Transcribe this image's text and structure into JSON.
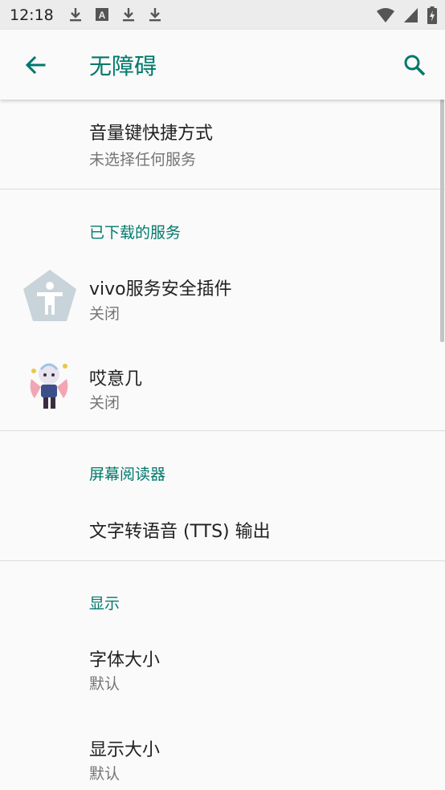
{
  "status_bar": {
    "time": "12:18",
    "left_icons": [
      "download-icon",
      "text-a-icon",
      "download-icon",
      "download-icon"
    ],
    "right_icons": [
      "wifi-icon",
      "cell-signal-icon",
      "battery-charging-icon"
    ]
  },
  "app_bar": {
    "title": "无障碍",
    "back_icon": "arrow-back-icon",
    "search_icon": "search-icon",
    "accent_color": "#00796b"
  },
  "items": {
    "volume_shortcut": {
      "title": "音量键快捷方式",
      "subtitle": "未选择任何服务"
    },
    "downloaded_header": "已下载的服务",
    "vivo_service": {
      "title": "vivo服务安全插件",
      "subtitle": "关闭",
      "icon": "accessibility-pentagon-icon"
    },
    "aiyiji": {
      "title": "哎意几",
      "subtitle": "关闭",
      "icon": "anime-character-icon"
    },
    "screen_reader_header": "屏幕阅读器",
    "tts": {
      "title": "文字转语音 (TTS) 输出"
    },
    "display_header": "显示",
    "font_size": {
      "title": "字体大小",
      "subtitle": "默认"
    },
    "display_size": {
      "title": "显示大小",
      "subtitle": "默认"
    }
  }
}
